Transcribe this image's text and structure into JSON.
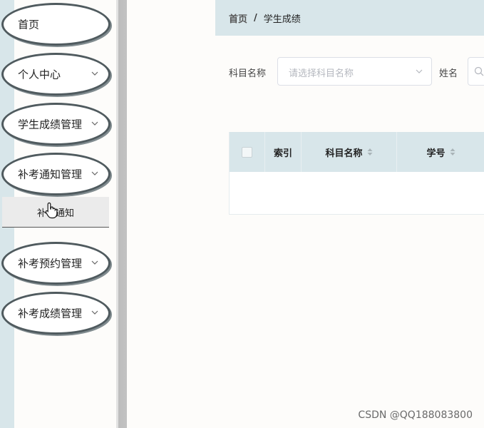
{
  "sidebar": {
    "items": [
      {
        "label": "首页",
        "has_chevron": false
      },
      {
        "label": "个人中心",
        "has_chevron": true
      },
      {
        "label": "学生成绩管理",
        "has_chevron": true
      },
      {
        "label": "补考通知管理",
        "has_chevron": true
      },
      {
        "label": "补考预约管理",
        "has_chevron": true
      },
      {
        "label": "补考成绩管理",
        "has_chevron": true
      }
    ],
    "submenu_item": "补考通知"
  },
  "breadcrumb": {
    "home": "首页",
    "separator": "/",
    "current": "学生成绩"
  },
  "search": {
    "subject_label": "科目名称",
    "subject_placeholder": "请选择科目名称",
    "name_label": "姓名"
  },
  "table": {
    "columns": [
      "索引",
      "科目名称",
      "学号"
    ]
  },
  "watermark": "CSDN @QQ188083800",
  "colors": {
    "accent_bg": "#d8e6ea",
    "oval_border": "#4f5a5e"
  },
  "icons": [
    "chevron-down-icon",
    "search-icon",
    "sort-icon",
    "hand-cursor-icon"
  ]
}
